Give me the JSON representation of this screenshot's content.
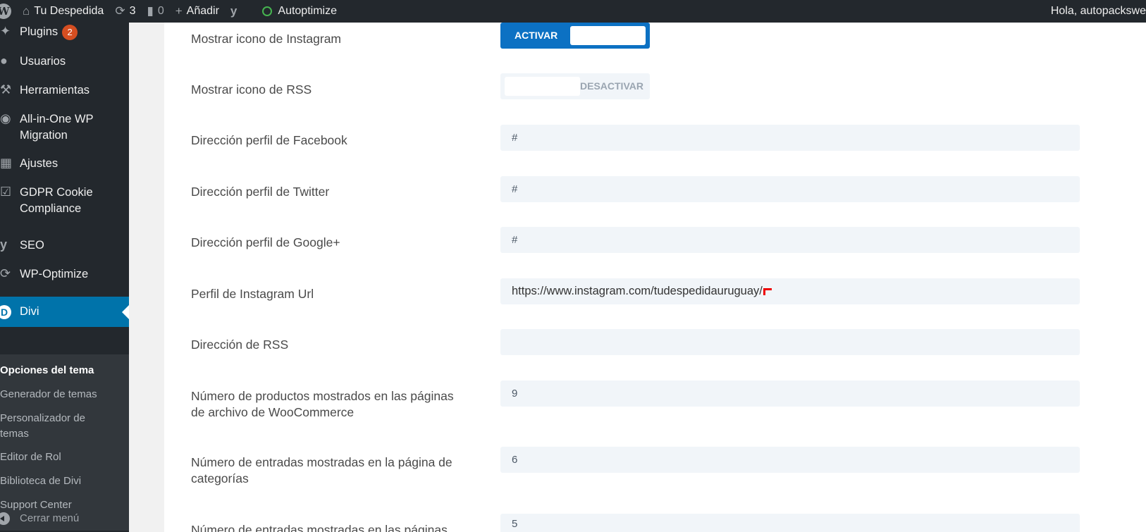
{
  "adminbar": {
    "site_name": "Tu Despedida",
    "updates_count": "3",
    "comments_count": "0",
    "add_new": "Añadir",
    "autoptimize": "Autoptimize",
    "howdy": "Hola, autopackswe"
  },
  "sidebar": {
    "items": [
      {
        "label": "Plugins",
        "badge": "2",
        "icon": "plug-icon"
      },
      {
        "label": "Usuarios",
        "icon": "user-icon"
      },
      {
        "label": "Herramientas",
        "icon": "wrench-icon"
      },
      {
        "label": "All-in-One WP Migration",
        "icon": "migration-icon"
      },
      {
        "label": "Ajustes",
        "icon": "settings-icon"
      },
      {
        "label": "GDPR Cookie Compliance",
        "icon": "check-shield-icon"
      },
      {
        "label": "SEO",
        "icon": "yoast-icon"
      },
      {
        "label": "WP-Optimize",
        "icon": "optimize-icon"
      },
      {
        "label": "Divi",
        "icon": "divi-icon"
      }
    ],
    "submenu": [
      "Opciones del tema",
      "Generador de temas",
      "Personalizador de temas",
      "Editor de Rol",
      "Biblioteca de Divi",
      "Support Center"
    ],
    "collapse": "Cerrar menú"
  },
  "settings": {
    "instagram_icon": {
      "label": "Mostrar icono de Instagram",
      "state": "ACTIVAR"
    },
    "rss_icon": {
      "label": "Mostrar icono de RSS",
      "state": "DESACTIVAR"
    },
    "facebook": {
      "label": "Dirección perfil de Facebook",
      "value": "#"
    },
    "twitter": {
      "label": "Dirección perfil de Twitter",
      "value": "#"
    },
    "google": {
      "label": "Dirección perfil de Google+",
      "value": "#"
    },
    "instagram_url": {
      "label": "Perfil de Instagram Url",
      "value": "https://www.instagram.com/tudespedidauruguay/"
    },
    "rss_url": {
      "label": "Dirección de RSS",
      "value": ""
    },
    "woo_products": {
      "label": "Número de productos mostrados en las páginas de archivo de WooCommerce",
      "value": "9"
    },
    "category_posts": {
      "label": "Número de entradas mostradas en la página de categorías",
      "value": "6"
    },
    "archive_posts": {
      "label": "Número de entradas mostradas en las páginas",
      "value": "5"
    }
  },
  "colors": {
    "admin_bar": "#23282d",
    "active_menu": "#0073aa",
    "toggle_on": "#0c71c3",
    "badge": "#d54e21"
  }
}
